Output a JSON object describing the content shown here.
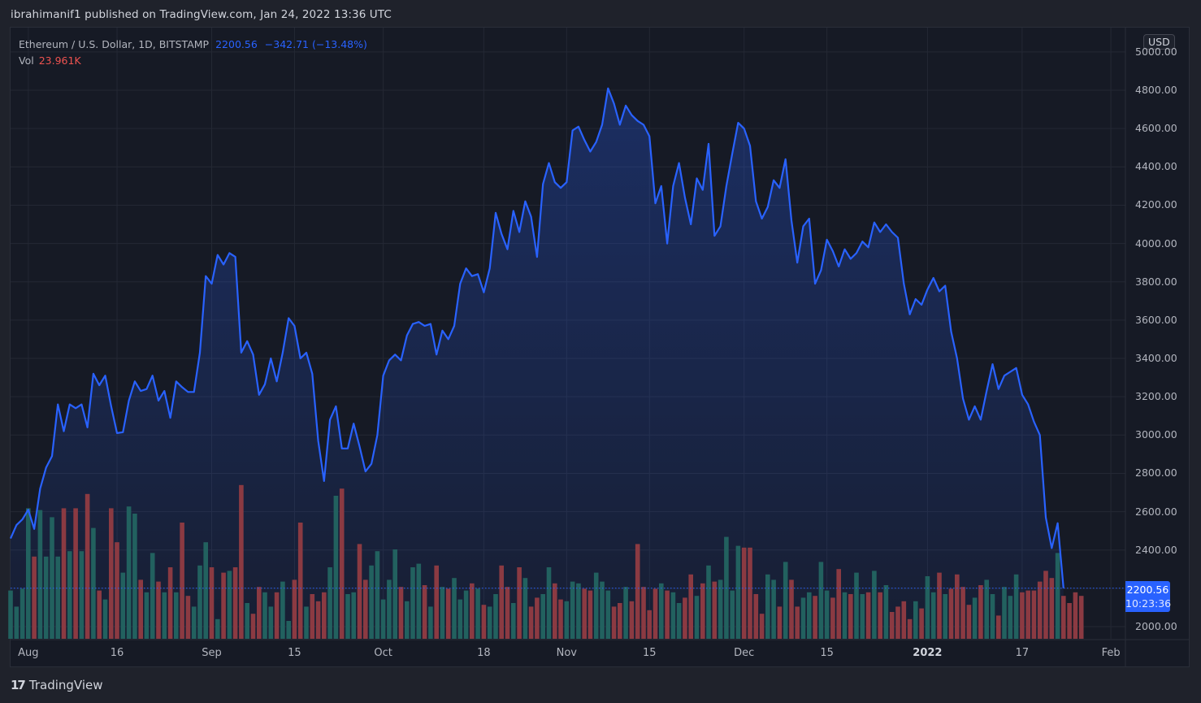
{
  "header": {
    "published": "ibrahimanif1 published on TradingView.com, Jan 24, 2022 13:36 UTC"
  },
  "legend": {
    "symbol": "Ethereum / U.S. Dollar, 1D, BITSTAMP",
    "last_price": "2200.56",
    "change": "−342.71 (−13.48%)",
    "vol_label": "Vol",
    "vol_value": "23.961K"
  },
  "price_axis": {
    "currency": "USD",
    "current_price": "2200.56",
    "countdown": "10:23:36"
  },
  "footer": {
    "logo_glyph": "17",
    "brand": "TradingView"
  },
  "colors": {
    "line": "#2962ff",
    "up_volume": "#22615f",
    "down_volume": "#8b3a42",
    "background": "#161a25",
    "grid": "#242834"
  },
  "chart_data": {
    "type": "area",
    "title": "Ethereum / U.S. Dollar, 1D, BITSTAMP",
    "xlabel": "",
    "ylabel": "USD",
    "ylim": [
      1940,
      5060
    ],
    "grid": true,
    "start_date": "2021-07-29",
    "x_ticks": [
      {
        "label": "Aug",
        "index": 3,
        "bold": false
      },
      {
        "label": "16",
        "index": 18,
        "bold": false
      },
      {
        "label": "Sep",
        "index": 34,
        "bold": false
      },
      {
        "label": "15",
        "index": 48,
        "bold": false
      },
      {
        "label": "Oct",
        "index": 63,
        "bold": false
      },
      {
        "label": "18",
        "index": 80,
        "bold": false
      },
      {
        "label": "Nov",
        "index": 94,
        "bold": false
      },
      {
        "label": "15",
        "index": 108,
        "bold": false
      },
      {
        "label": "Dec",
        "index": 124,
        "bold": false
      },
      {
        "label": "15",
        "index": 138,
        "bold": false
      },
      {
        "label": "2022",
        "index": 155,
        "bold": true
      },
      {
        "label": "17",
        "index": 171,
        "bold": false
      },
      {
        "label": "Feb",
        "index": 186,
        "bold": false
      }
    ],
    "y_ticks": [
      "2000.00",
      "2400.00",
      "2600.00",
      "2800.00",
      "3000.00",
      "3200.00",
      "3400.00",
      "3600.00",
      "3800.00",
      "4000.00",
      "4200.00",
      "4400.00",
      "4600.00",
      "4800.00",
      "5000.00"
    ],
    "series": [
      {
        "name": "Close",
        "values": [
          2460,
          2530,
          2560,
          2610,
          2510,
          2720,
          2830,
          2890,
          3160,
          3020,
          3160,
          3140,
          3160,
          3040,
          3320,
          3260,
          3310,
          3150,
          3010,
          3015,
          3180,
          3280,
          3230,
          3240,
          3310,
          3180,
          3230,
          3090,
          3280,
          3250,
          3225,
          3225,
          3430,
          3830,
          3790,
          3940,
          3890,
          3950,
          3930,
          3430,
          3490,
          3420,
          3210,
          3265,
          3400,
          3280,
          3430,
          3610,
          3570,
          3400,
          3430,
          3320,
          2970,
          2760,
          3080,
          3150,
          2930,
          2930,
          3060,
          2940,
          2810,
          2850,
          3000,
          3310,
          3390,
          3420,
          3390,
          3520,
          3580,
          3590,
          3570,
          3580,
          3420,
          3545,
          3500,
          3570,
          3790,
          3870,
          3830,
          3840,
          3745,
          3870,
          4160,
          4050,
          3970,
          4170,
          4060,
          4220,
          4140,
          3930,
          4310,
          4420,
          4320,
          4290,
          4320,
          4590,
          4610,
          4540,
          4480,
          4530,
          4620,
          4810,
          4730,
          4620,
          4720,
          4670,
          4640,
          4620,
          4560,
          4210,
          4300,
          4000,
          4300,
          4420,
          4240,
          4100,
          4340,
          4280,
          4520,
          4040,
          4090,
          4300,
          4470,
          4630,
          4600,
          4510,
          4220,
          4130,
          4190,
          4330,
          4290,
          4440,
          4120,
          3900,
          4090,
          4130,
          3790,
          3860,
          4020,
          3960,
          3880,
          3970,
          3920,
          3950,
          4010,
          3980,
          4110,
          4060,
          4100,
          4060,
          4030,
          3790,
          3630,
          3710,
          3680,
          3760,
          3820,
          3750,
          3780,
          3540,
          3400,
          3190,
          3080,
          3150,
          3080,
          3230,
          3370,
          3240,
          3310,
          3330,
          3350,
          3210,
          3160,
          3070,
          3000,
          2570,
          2410,
          2540,
          2200.56
        ]
      },
      {
        "name": "Volume (K)",
        "values": [
          27,
          18,
          28,
          73,
          46,
          72,
          46,
          68,
          46,
          73,
          49,
          73,
          49,
          81,
          62,
          27,
          22,
          73,
          54,
          37,
          74,
          70,
          33,
          26,
          48,
          32,
          26,
          40,
          26,
          65,
          24,
          18,
          41,
          54,
          40,
          11,
          37,
          38,
          40,
          86,
          20,
          14,
          29,
          26,
          18,
          26,
          32,
          10,
          33,
          65,
          18,
          25,
          21,
          26,
          40,
          80,
          84,
          25,
          26,
          53,
          33,
          41,
          49,
          22,
          33,
          50,
          29,
          21,
          40,
          42,
          30,
          18,
          41,
          29,
          28,
          34,
          22,
          27,
          31,
          28,
          19,
          18,
          25,
          41,
          29,
          20,
          40,
          34,
          18,
          23,
          25,
          40,
          31,
          22,
          21,
          32,
          31,
          28,
          27,
          37,
          32,
          27,
          18,
          20,
          29,
          21,
          53,
          29,
          16,
          28,
          31,
          27,
          26,
          20,
          23,
          36,
          24,
          31,
          41,
          32,
          33,
          57,
          27,
          52,
          51,
          51,
          25,
          14,
          36,
          33,
          18,
          43,
          33,
          18,
          23,
          26,
          24,
          43,
          27,
          23,
          39,
          26,
          25,
          37,
          25,
          26,
          38,
          26,
          30,
          15,
          18,
          21,
          11,
          21,
          17,
          35,
          26,
          37,
          25,
          28,
          36,
          29,
          19,
          23,
          30,
          33,
          25,
          13,
          29,
          24,
          36,
          26,
          27,
          27,
          32,
          38,
          34,
          48,
          24,
          20,
          26,
          24
        ]
      }
    ],
    "volume_direction": "up if close >= previous close, down otherwise",
    "current_price_line": 2200.56
  }
}
